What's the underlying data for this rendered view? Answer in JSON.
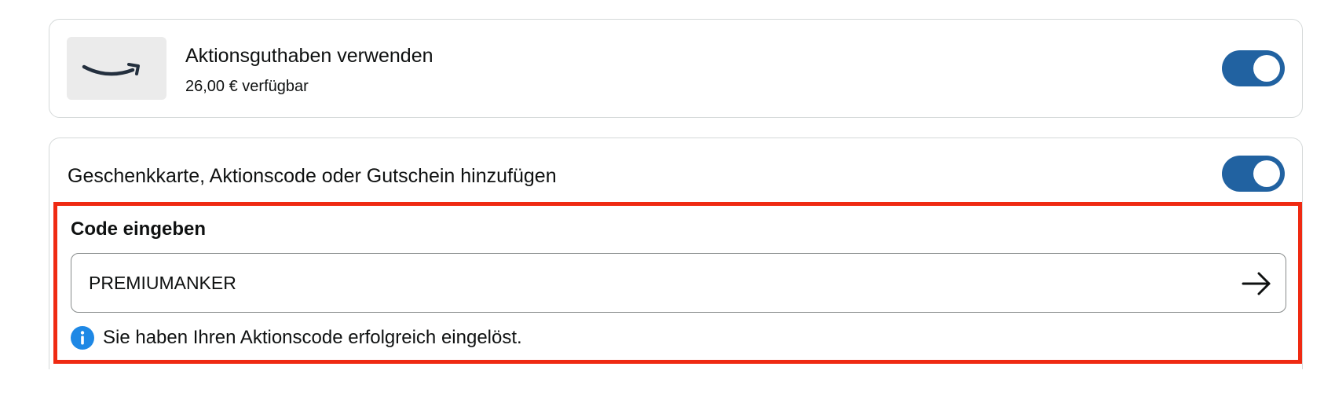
{
  "promo_credit": {
    "logo": "amazon-smile-logo",
    "title": "Aktionsguthaben verwenden",
    "available": "26,00 € verfügbar",
    "toggle_on": true
  },
  "gift_card": {
    "title": "Geschenkkarte, Aktionscode oder Gutschein hinzufügen",
    "toggle_on": true,
    "code_label": "Code eingeben",
    "code_value": "PREMIUMANKER",
    "submit_icon": "arrow-right-icon",
    "info_icon": "info-icon",
    "success_message": "Sie haben Ihren Aktionscode erfolgreich eingelöst."
  },
  "colors": {
    "toggle": "#2162a1",
    "highlight_border": "#ef2a12",
    "info": "#1e88e5",
    "logo_tile": "#ebebeb",
    "card_border": "#d5d9d9"
  }
}
